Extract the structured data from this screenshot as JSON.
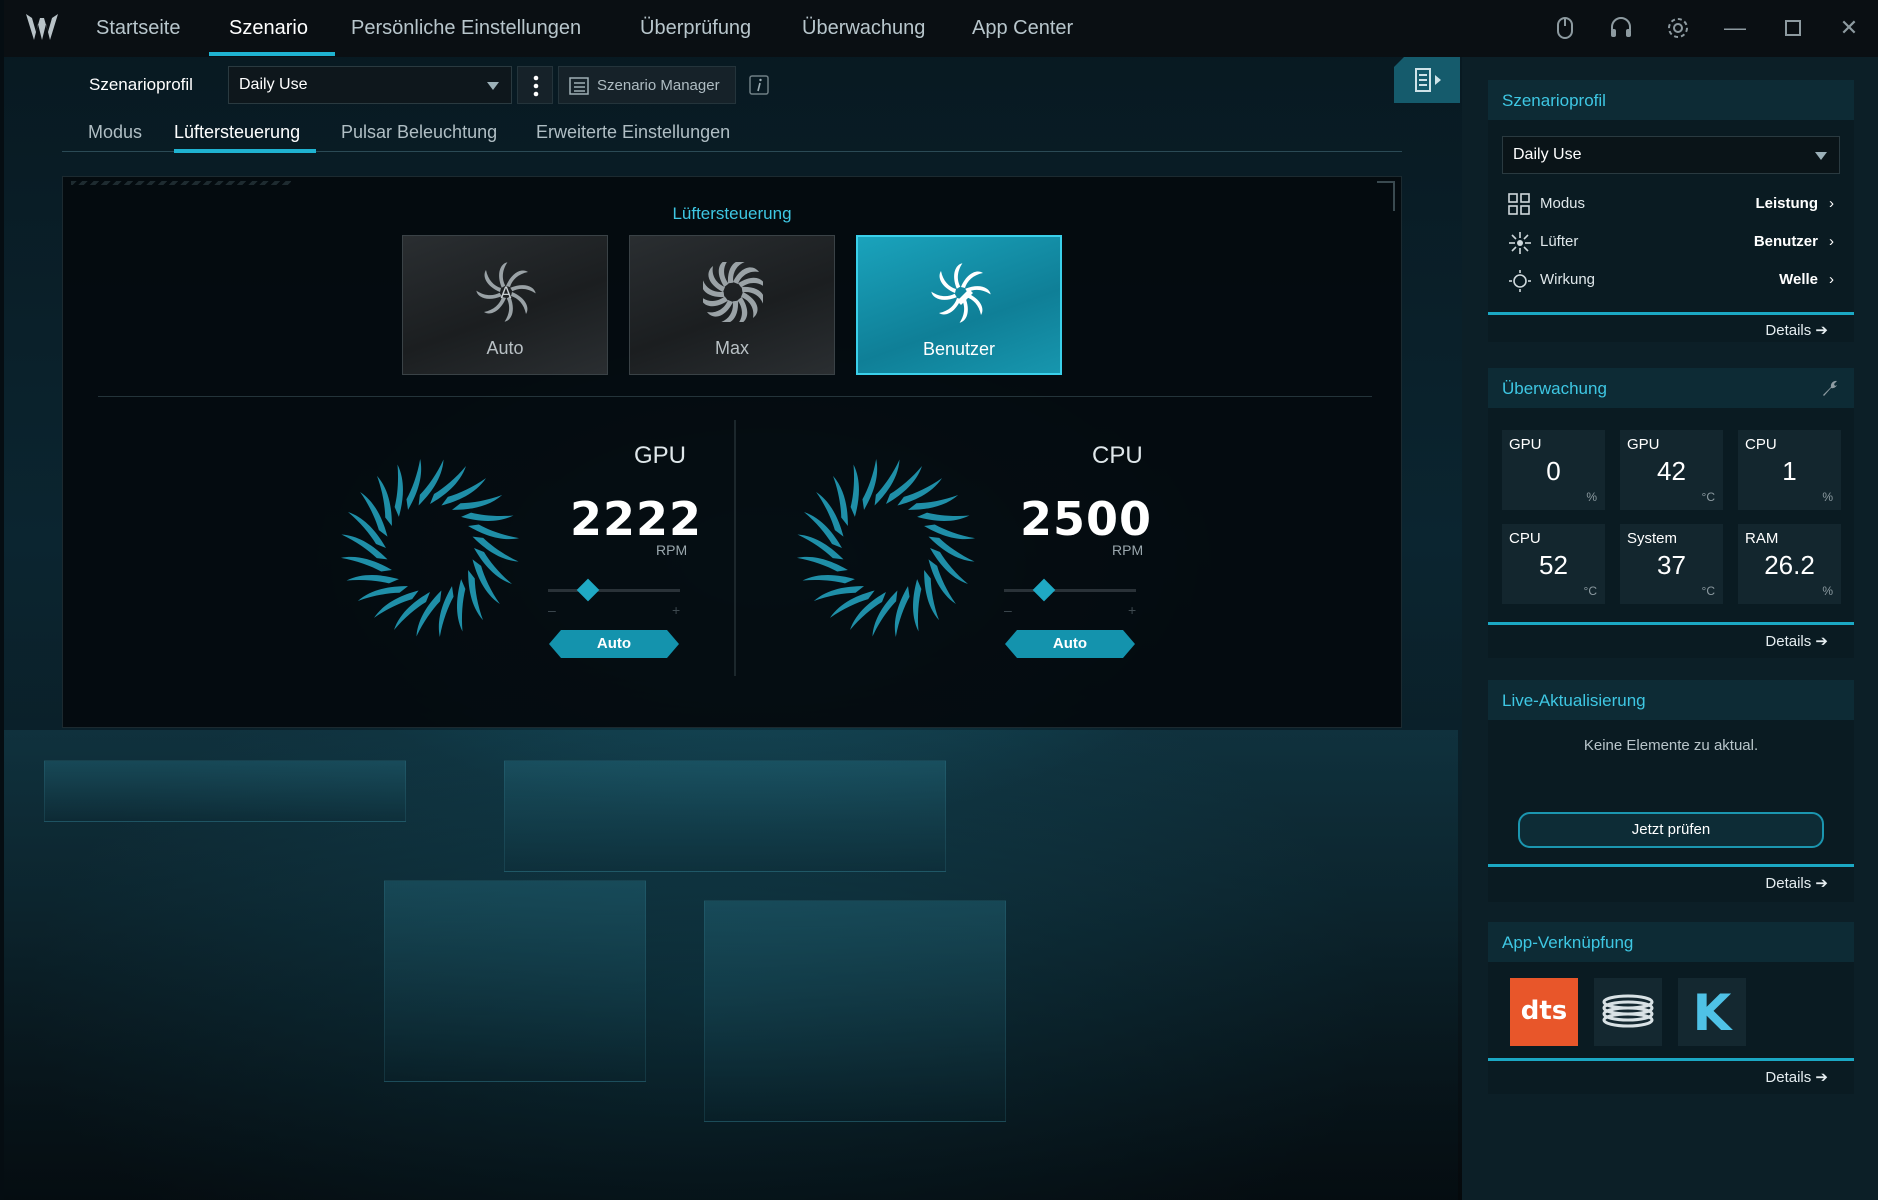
{
  "nav": {
    "items": [
      "Startseite",
      "Szenario",
      "Persönliche Einstellungen",
      "Überprüfung",
      "Überwachung",
      "App Center"
    ],
    "active": "Szenario"
  },
  "scenario": {
    "profile_label": "Szenarioprofil",
    "profile_value": "Daily Use",
    "manager_label": "Szenario Manager"
  },
  "subtabs": [
    "Modus",
    "Lüftersteuerung",
    "Pulsar Beleuchtung",
    "Erweiterte Einstellungen"
  ],
  "fan_control": {
    "title": "Lüftersteuerung",
    "modes": [
      "Auto",
      "Max",
      "Benutzer"
    ],
    "active_mode": "Benutzer",
    "fans": [
      {
        "name": "GPU",
        "rpm": "2222",
        "unit": "RPM",
        "auto_label": "Auto",
        "minus": "–",
        "plus": "+",
        "level": 0.3
      },
      {
        "name": "CPU",
        "rpm": "2500",
        "unit": "RPM",
        "auto_label": "Auto",
        "minus": "–",
        "plus": "+",
        "level": 0.3
      }
    ]
  },
  "sidebar": {
    "profile_card": {
      "title": "Szenarioprofil",
      "select_value": "Daily Use",
      "rows": [
        {
          "icon": "grid-icon",
          "label": "Modus",
          "value": "Leistung"
        },
        {
          "icon": "fan-icon",
          "label": "Lüfter",
          "value": "Benutzer"
        },
        {
          "icon": "sun-icon",
          "label": "Wirkung",
          "value": "Welle"
        }
      ],
      "details": "Details"
    },
    "monitor_card": {
      "title": "Überwachung",
      "tiles": [
        {
          "label": "GPU",
          "value": "0",
          "unit": "%"
        },
        {
          "label": "GPU",
          "value": "42",
          "unit": "°C"
        },
        {
          "label": "CPU",
          "value": "1",
          "unit": "%"
        },
        {
          "label": "CPU",
          "value": "52",
          "unit": "°C"
        },
        {
          "label": "System",
          "value": "37",
          "unit": "°C"
        },
        {
          "label": "RAM",
          "value": "26.2",
          "unit": "%"
        }
      ],
      "details": "Details"
    },
    "live_card": {
      "title": "Live-Aktualisierung",
      "message": "Keine Elemente zu aktual.",
      "button": "Jetzt prüfen",
      "details": "Details"
    },
    "apps_card": {
      "title": "App-Verknüpfung",
      "apps": [
        "dts",
        "NitroSense",
        "K"
      ],
      "details": "Details"
    }
  },
  "colors": {
    "accent": "#1fb3d1",
    "accent_dark": "#1493ad",
    "dts": "#e8562a"
  }
}
